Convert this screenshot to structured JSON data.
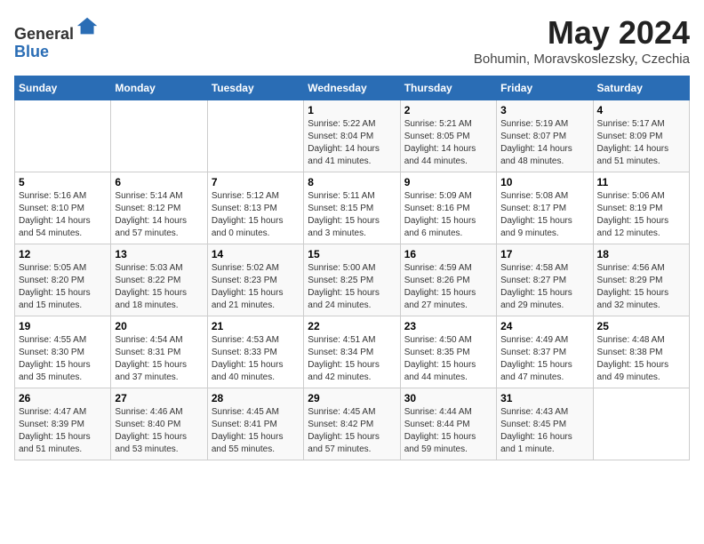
{
  "header": {
    "logo_line1": "General",
    "logo_line2": "Blue",
    "month_title": "May 2024",
    "location": "Bohumin, Moravskoslezsky, Czechia"
  },
  "days_of_week": [
    "Sunday",
    "Monday",
    "Tuesday",
    "Wednesday",
    "Thursday",
    "Friday",
    "Saturday"
  ],
  "weeks": [
    [
      {
        "day": "",
        "info": ""
      },
      {
        "day": "",
        "info": ""
      },
      {
        "day": "",
        "info": ""
      },
      {
        "day": "1",
        "info": "Sunrise: 5:22 AM\nSunset: 8:04 PM\nDaylight: 14 hours\nand 41 minutes."
      },
      {
        "day": "2",
        "info": "Sunrise: 5:21 AM\nSunset: 8:05 PM\nDaylight: 14 hours\nand 44 minutes."
      },
      {
        "day": "3",
        "info": "Sunrise: 5:19 AM\nSunset: 8:07 PM\nDaylight: 14 hours\nand 48 minutes."
      },
      {
        "day": "4",
        "info": "Sunrise: 5:17 AM\nSunset: 8:09 PM\nDaylight: 14 hours\nand 51 minutes."
      }
    ],
    [
      {
        "day": "5",
        "info": "Sunrise: 5:16 AM\nSunset: 8:10 PM\nDaylight: 14 hours\nand 54 minutes."
      },
      {
        "day": "6",
        "info": "Sunrise: 5:14 AM\nSunset: 8:12 PM\nDaylight: 14 hours\nand 57 minutes."
      },
      {
        "day": "7",
        "info": "Sunrise: 5:12 AM\nSunset: 8:13 PM\nDaylight: 15 hours\nand 0 minutes."
      },
      {
        "day": "8",
        "info": "Sunrise: 5:11 AM\nSunset: 8:15 PM\nDaylight: 15 hours\nand 3 minutes."
      },
      {
        "day": "9",
        "info": "Sunrise: 5:09 AM\nSunset: 8:16 PM\nDaylight: 15 hours\nand 6 minutes."
      },
      {
        "day": "10",
        "info": "Sunrise: 5:08 AM\nSunset: 8:17 PM\nDaylight: 15 hours\nand 9 minutes."
      },
      {
        "day": "11",
        "info": "Sunrise: 5:06 AM\nSunset: 8:19 PM\nDaylight: 15 hours\nand 12 minutes."
      }
    ],
    [
      {
        "day": "12",
        "info": "Sunrise: 5:05 AM\nSunset: 8:20 PM\nDaylight: 15 hours\nand 15 minutes."
      },
      {
        "day": "13",
        "info": "Sunrise: 5:03 AM\nSunset: 8:22 PM\nDaylight: 15 hours\nand 18 minutes."
      },
      {
        "day": "14",
        "info": "Sunrise: 5:02 AM\nSunset: 8:23 PM\nDaylight: 15 hours\nand 21 minutes."
      },
      {
        "day": "15",
        "info": "Sunrise: 5:00 AM\nSunset: 8:25 PM\nDaylight: 15 hours\nand 24 minutes."
      },
      {
        "day": "16",
        "info": "Sunrise: 4:59 AM\nSunset: 8:26 PM\nDaylight: 15 hours\nand 27 minutes."
      },
      {
        "day": "17",
        "info": "Sunrise: 4:58 AM\nSunset: 8:27 PM\nDaylight: 15 hours\nand 29 minutes."
      },
      {
        "day": "18",
        "info": "Sunrise: 4:56 AM\nSunset: 8:29 PM\nDaylight: 15 hours\nand 32 minutes."
      }
    ],
    [
      {
        "day": "19",
        "info": "Sunrise: 4:55 AM\nSunset: 8:30 PM\nDaylight: 15 hours\nand 35 minutes."
      },
      {
        "day": "20",
        "info": "Sunrise: 4:54 AM\nSunset: 8:31 PM\nDaylight: 15 hours\nand 37 minutes."
      },
      {
        "day": "21",
        "info": "Sunrise: 4:53 AM\nSunset: 8:33 PM\nDaylight: 15 hours\nand 40 minutes."
      },
      {
        "day": "22",
        "info": "Sunrise: 4:51 AM\nSunset: 8:34 PM\nDaylight: 15 hours\nand 42 minutes."
      },
      {
        "day": "23",
        "info": "Sunrise: 4:50 AM\nSunset: 8:35 PM\nDaylight: 15 hours\nand 44 minutes."
      },
      {
        "day": "24",
        "info": "Sunrise: 4:49 AM\nSunset: 8:37 PM\nDaylight: 15 hours\nand 47 minutes."
      },
      {
        "day": "25",
        "info": "Sunrise: 4:48 AM\nSunset: 8:38 PM\nDaylight: 15 hours\nand 49 minutes."
      }
    ],
    [
      {
        "day": "26",
        "info": "Sunrise: 4:47 AM\nSunset: 8:39 PM\nDaylight: 15 hours\nand 51 minutes."
      },
      {
        "day": "27",
        "info": "Sunrise: 4:46 AM\nSunset: 8:40 PM\nDaylight: 15 hours\nand 53 minutes."
      },
      {
        "day": "28",
        "info": "Sunrise: 4:45 AM\nSunset: 8:41 PM\nDaylight: 15 hours\nand 55 minutes."
      },
      {
        "day": "29",
        "info": "Sunrise: 4:45 AM\nSunset: 8:42 PM\nDaylight: 15 hours\nand 57 minutes."
      },
      {
        "day": "30",
        "info": "Sunrise: 4:44 AM\nSunset: 8:44 PM\nDaylight: 15 hours\nand 59 minutes."
      },
      {
        "day": "31",
        "info": "Sunrise: 4:43 AM\nSunset: 8:45 PM\nDaylight: 16 hours\nand 1 minute."
      },
      {
        "day": "",
        "info": ""
      }
    ]
  ]
}
